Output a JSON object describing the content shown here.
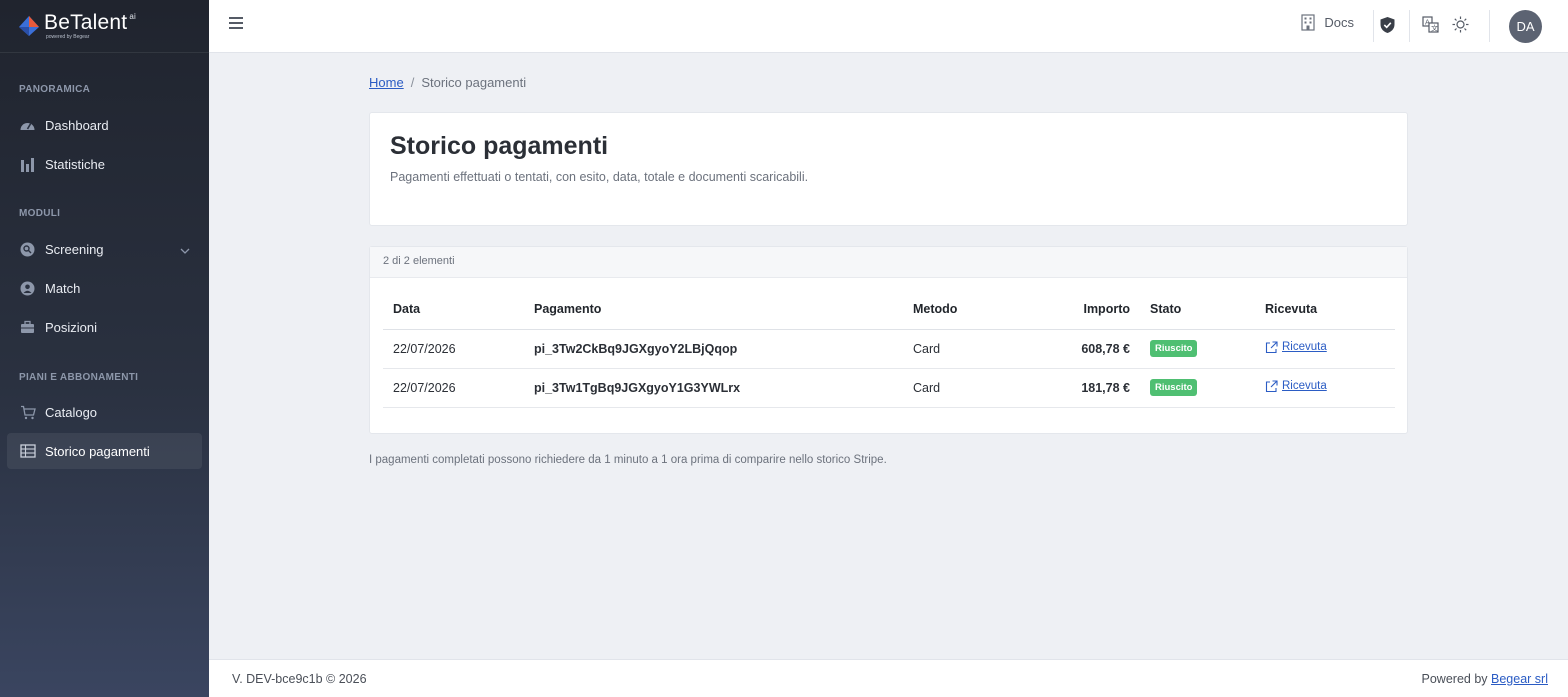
{
  "brand": {
    "name": "BeTalent",
    "sup": "ai",
    "sub": "powered by Begear"
  },
  "sidebar": {
    "sections": [
      {
        "title": "PANORAMICA",
        "items": [
          {
            "label": "Dashboard",
            "icon": "gauge-icon"
          },
          {
            "label": "Statistiche",
            "icon": "bar-chart-icon"
          }
        ]
      },
      {
        "title": "MODULI",
        "items": [
          {
            "label": "Screening",
            "icon": "screening-icon"
          },
          {
            "label": "Match",
            "icon": "user-circle-icon"
          },
          {
            "label": "Posizioni",
            "icon": "briefcase-icon"
          }
        ]
      },
      {
        "title": "PIANI E ABBONAMENTI",
        "items": [
          {
            "label": "Catalogo",
            "icon": "cart-icon"
          },
          {
            "label": "Storico pagamenti",
            "icon": "table-icon",
            "active": true
          }
        ]
      }
    ]
  },
  "topbar": {
    "docs_label": "Docs",
    "avatar_initials": "DA"
  },
  "breadcrumb": {
    "home": "Home",
    "current": "Storico pagamenti"
  },
  "header": {
    "title": "Storico pagamenti",
    "subtitle": "Pagamenti effettuati o tentati, con esito, data, totale e documenti scaricabili."
  },
  "table": {
    "count_text": "2 di 2 elementi",
    "columns": [
      "Data",
      "Pagamento",
      "Metodo",
      "Importo",
      "Stato",
      "Ricevuta"
    ],
    "rows": [
      {
        "date": "22/07/2026",
        "payment": "pi_3Tw2CkBq9JGXgyoY2LBjQqop",
        "method": "Card",
        "amount": "608,78 €",
        "status": "Riuscito",
        "receipt": "Ricevuta"
      },
      {
        "date": "22/07/2026",
        "payment": "pi_3Tw1TgBq9JGXgyoY1G3YWLrx",
        "method": "Card",
        "amount": "181,78 €",
        "status": "Riuscito",
        "receipt": "Ricevuta"
      }
    ]
  },
  "note": "I pagamenti completati possono richiedere da 1 minuto a 1 ora prima di comparire nello storico Stripe.",
  "footer": {
    "version": "V. DEV-bce9c1b © 2026",
    "powered_prefix": "Powered by",
    "powered_link": "Begear srl"
  },
  "colors": {
    "accent": "#2b5cc4",
    "success": "#4fbf72",
    "sidebar_top": "#20242e",
    "sidebar_bottom": "#3a4560"
  }
}
